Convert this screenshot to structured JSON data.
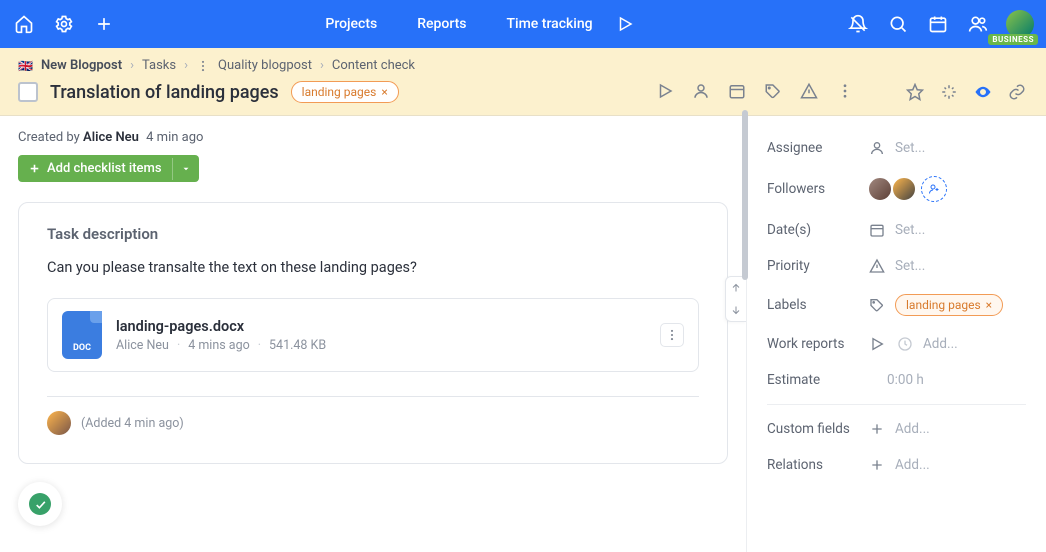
{
  "topnav": {
    "projects": "Projects",
    "reports": "Reports",
    "time": "Time tracking"
  },
  "badge": "BUSINESS",
  "breadcrumb": {
    "flag": "🇬🇧",
    "c1": "New Blogpost",
    "c2": "Tasks",
    "c3": "Quality blogpost",
    "c4": "Content check"
  },
  "task": {
    "title": "Translation of landing pages",
    "label": "landing pages"
  },
  "meta": {
    "created_prefix": "Created by ",
    "author": "Alice Neu",
    "created_time": "4 min ago"
  },
  "checklist_btn": "Add checklist items",
  "card": {
    "heading": "Task description",
    "body": "Can you please transalte the text on these landing pages?"
  },
  "attachment": {
    "badge": "DOC",
    "name": "landing-pages.docx",
    "author": "Alice Neu",
    "time": "4 mins ago",
    "size": "541.48 KB"
  },
  "added_note": "(Added 4 min ago)",
  "sidebar": {
    "assignee": {
      "label": "Assignee",
      "value": "Set..."
    },
    "followers": {
      "label": "Followers"
    },
    "dates": {
      "label": "Date(s)",
      "value": "Set..."
    },
    "priority": {
      "label": "Priority",
      "value": "Set..."
    },
    "labels": {
      "label": "Labels",
      "pill": "landing pages"
    },
    "reports": {
      "label": "Work reports",
      "value": "Add..."
    },
    "estimate": {
      "label": "Estimate",
      "value": "0:00 h"
    },
    "custom": {
      "label": "Custom fields",
      "value": "Add..."
    },
    "relations": {
      "label": "Relations",
      "value": "Add..."
    }
  }
}
